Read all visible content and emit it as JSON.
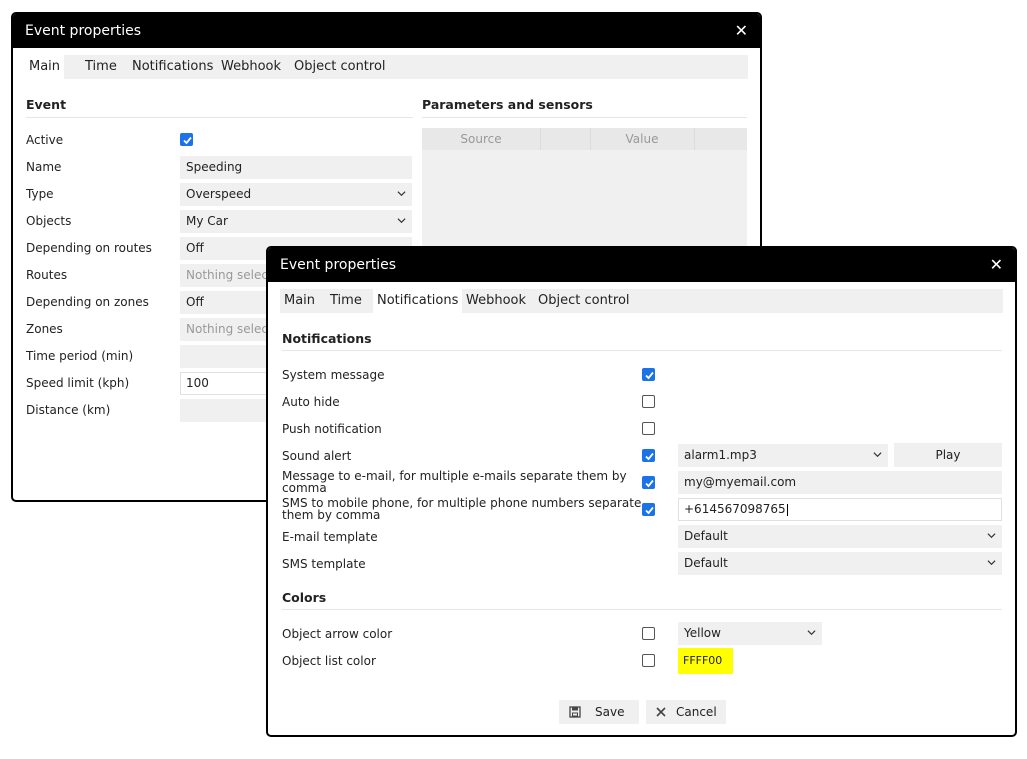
{
  "back_dialog": {
    "title": "Event properties",
    "close": "✕",
    "tabs": [
      "Main",
      "Time",
      "Notifications",
      "Webhook",
      "Object control"
    ],
    "event_heading": "Event",
    "params_heading": "Parameters and sensors",
    "params_columns": [
      "Source",
      "Value"
    ],
    "fields": {
      "active": {
        "label": "Active",
        "checked": true
      },
      "name": {
        "label": "Name",
        "value": "Speeding"
      },
      "type": {
        "label": "Type",
        "value": "Overspeed"
      },
      "objects": {
        "label": "Objects",
        "value": "My Car"
      },
      "depending_routes": {
        "label": "Depending on routes",
        "value": "Off"
      },
      "routes": {
        "label": "Routes",
        "value": "Nothing selecte"
      },
      "depending_zones": {
        "label": "Depending on zones",
        "value": "Off"
      },
      "zones": {
        "label": "Zones",
        "value": "Nothing selecte"
      },
      "time_period": {
        "label": "Time period (min)",
        "value": ""
      },
      "speed_limit": {
        "label": "Speed limit (kph)",
        "value": "100"
      },
      "distance": {
        "label": "Distance (km)",
        "value": ""
      }
    }
  },
  "front_dialog": {
    "title": "Event properties",
    "close": "✕",
    "tabs": [
      "Main",
      "Time",
      "Notifications",
      "Webhook",
      "Object control"
    ],
    "active_tab": "Notifications",
    "notifications_heading": "Notifications",
    "rows": {
      "system_message": {
        "label": "System message",
        "checked": true
      },
      "auto_hide": {
        "label": "Auto hide",
        "checked": false
      },
      "push_notification": {
        "label": "Push notification",
        "checked": false
      },
      "sound_alert": {
        "label": "Sound alert",
        "checked": true,
        "value": "alarm1.mp3",
        "button": "Play"
      },
      "email": {
        "label_line1": "Message to e-mail, for multiple e-mails separate them by",
        "label_line2": "comma",
        "checked": true,
        "value": "my@myemail.com"
      },
      "sms": {
        "label_line1": "SMS to mobile phone, for multiple phone numbers separate",
        "label_line2": "them by comma",
        "checked": true,
        "value": "+614567098765"
      },
      "email_template": {
        "label": "E-mail template",
        "value": "Default"
      },
      "sms_template": {
        "label": "SMS template",
        "value": "Default"
      }
    },
    "colors_heading": "Colors",
    "colors": {
      "arrow": {
        "label": "Object arrow color",
        "checked": false,
        "value": "Yellow"
      },
      "list": {
        "label": "Object list color",
        "checked": false,
        "value": "FFFF00",
        "swatch": "#ffff00"
      }
    },
    "buttons": {
      "save": "Save",
      "cancel": "Cancel"
    }
  },
  "colors": {
    "accent": "#1a73e8",
    "titlebar": "#000000"
  },
  "icons": {
    "close": "close-icon",
    "check": "check-icon",
    "chevron": "chevron-down-icon",
    "save": "floppy-icon",
    "cancel": "x-icon"
  }
}
